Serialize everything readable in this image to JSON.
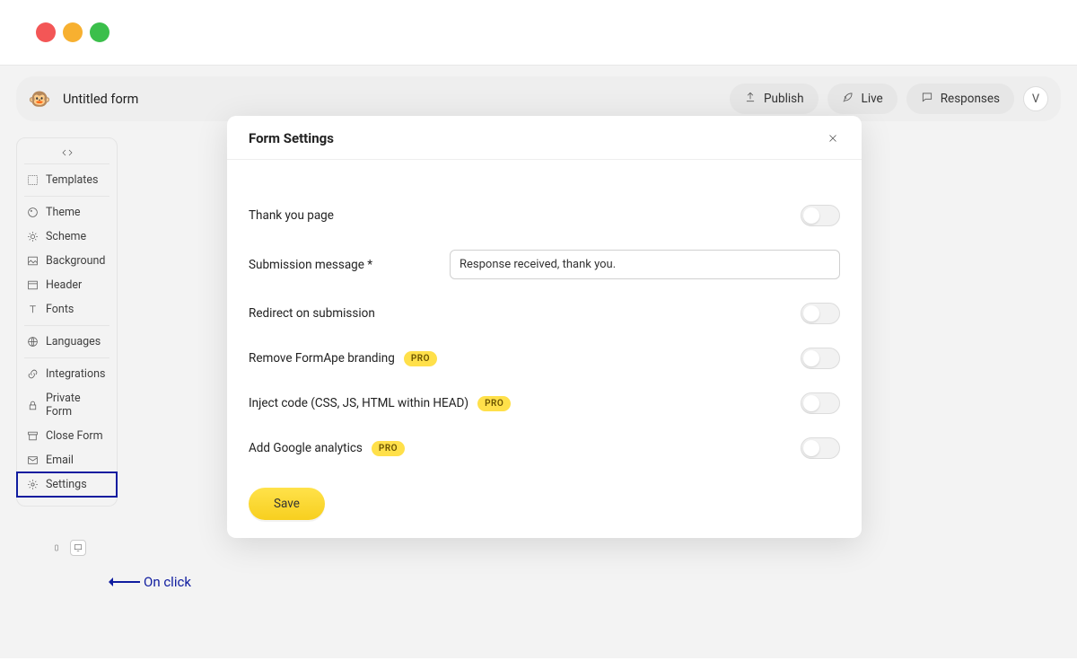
{
  "header": {
    "form_title": "Untitled form",
    "publish": "Publish",
    "live": "Live",
    "responses": "Responses",
    "user_initial": "V"
  },
  "sidebar": {
    "items": {
      "templates": "Templates",
      "theme": "Theme",
      "scheme": "Scheme",
      "background": "Background",
      "header": "Header",
      "fonts": "Fonts",
      "languages": "Languages",
      "integrations": "Integrations",
      "private": "Private Form",
      "close": "Close Form",
      "email": "Email",
      "settings": "Settings"
    }
  },
  "annotation": "On click",
  "modal": {
    "title": "Form Settings",
    "thank_you": "Thank you page",
    "submission_msg_label": "Submission message *",
    "submission_msg_value": "Response received, thank you.",
    "redirect": "Redirect on submission",
    "branding": "Remove FormApe branding",
    "inject": "Inject code (CSS, JS, HTML within HEAD)",
    "analytics": "Add Google analytics",
    "pro": "PRO",
    "save": "Save"
  }
}
